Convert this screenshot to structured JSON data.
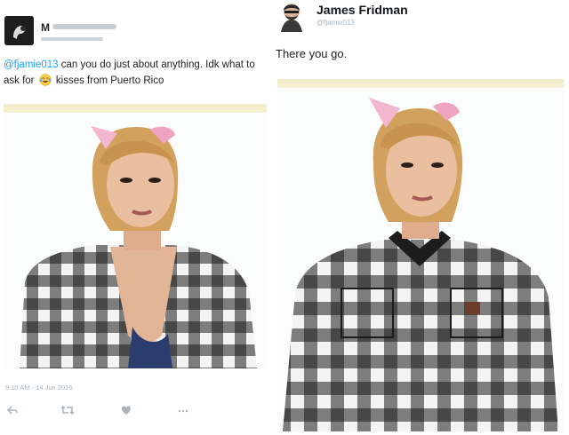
{
  "left_tweet": {
    "handle_mention": "@fjamie013",
    "text_before_emoji": " can you do just about anything. Idk what to ask for ",
    "text_after_emoji": " kisses from Puerto Rico",
    "emoji": "laughing-tears-emoji",
    "timestamp": "9:10 AM - 14 Jun 2016",
    "actions": {
      "reply_icon": "reply-icon",
      "retweet_icon": "retweet-icon",
      "like_icon": "heart-icon",
      "more_icon": "more-icon"
    }
  },
  "right_tweet": {
    "name": "James Fridman",
    "handle": "@fjamie013",
    "text": "There you go."
  },
  "colors": {
    "mention": "#1da1f2",
    "muted": "#a9b4bd",
    "bar": "#f3ecc9"
  }
}
